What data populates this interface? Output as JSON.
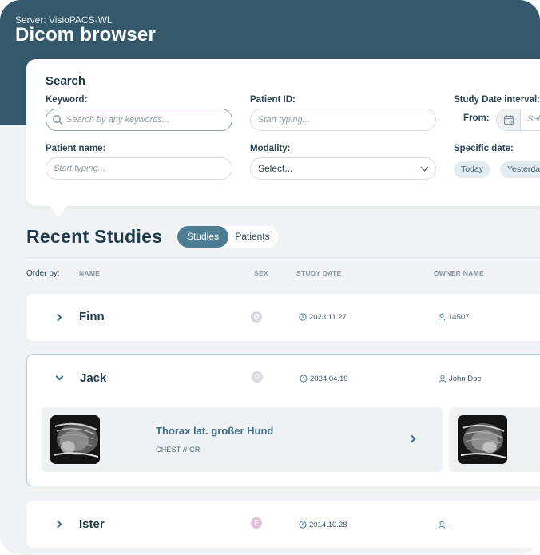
{
  "header": {
    "server": "Server: VisioPACS-WL",
    "title": "Dicom browser"
  },
  "search": {
    "heading": "Search",
    "keyword": {
      "label": "Keyword:",
      "placeholder": "Search by any keywords..."
    },
    "patient_id": {
      "label": "Patient ID:",
      "placeholder": "Start typing..."
    },
    "study_date_interval": {
      "label": "Study Date interval:",
      "from_label": "From:",
      "from_placeholder": "Sel"
    },
    "patient_name": {
      "label": "Patient name:",
      "placeholder": "Start typing..."
    },
    "modality": {
      "label": "Modality:",
      "value": "Select..."
    },
    "specific_date": {
      "label": "Specific date:",
      "chips": [
        "Today",
        "Yesterday"
      ]
    }
  },
  "recent": {
    "title": "Recent Studies",
    "toggle": {
      "active": "Studies",
      "inactive": "Patients"
    },
    "order_by": "Order by:",
    "columns": {
      "name": "NAME",
      "sex": "SEX",
      "study_date": "STUDY DATE",
      "owner": "OWNER NAME"
    },
    "rows": [
      {
        "name": "Finn",
        "sex": "O",
        "date": "2023.11.27",
        "owner": "14507",
        "expanded": false
      },
      {
        "name": "Jack",
        "sex": "O",
        "date": "2024.04.19",
        "owner": "John Doe",
        "expanded": true
      },
      {
        "name": "Ister",
        "sex": "F",
        "date": "2014.10.28",
        "owner": "-",
        "expanded": false
      }
    ],
    "study": {
      "title": "Thorax lat. großer Hund",
      "subtitle": "CHEST // CR"
    }
  },
  "colors": {
    "header_bg": "#35596b",
    "accent": "#4d7d92",
    "study_title": "#3c6e85",
    "female_badge": "#e2bfdc",
    "unknown_badge": "#d7dbdf"
  }
}
